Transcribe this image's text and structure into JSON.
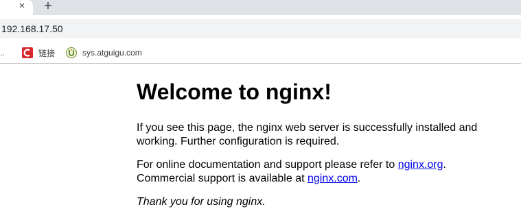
{
  "browser": {
    "tab": {
      "close_glyph": "×"
    },
    "new_tab_glyph": "+",
    "address": "192.168.17.50",
    "bookmarks_bar": {
      "overflow": "..",
      "items": [
        {
          "label": "链接",
          "icon": "csdn-icon",
          "icon_color": "#d7282f"
        },
        {
          "label": "sys.atguigu.com",
          "icon": "atguigu-icon",
          "icon_color": "#6a8f2c"
        }
      ]
    }
  },
  "page": {
    "title": "Welcome to nginx!",
    "p1": "If you see this page, the nginx web server is successfully installed and working. Further configuration is required.",
    "p2_prefix": "For online documentation and support please refer to ",
    "p2_link1": "nginx.org",
    "p2_middle": ".",
    "p2_line2_prefix": "Commercial support is available at ",
    "p2_link2": "nginx.com",
    "p2_suffix": ".",
    "p3": "Thank you for using nginx."
  }
}
